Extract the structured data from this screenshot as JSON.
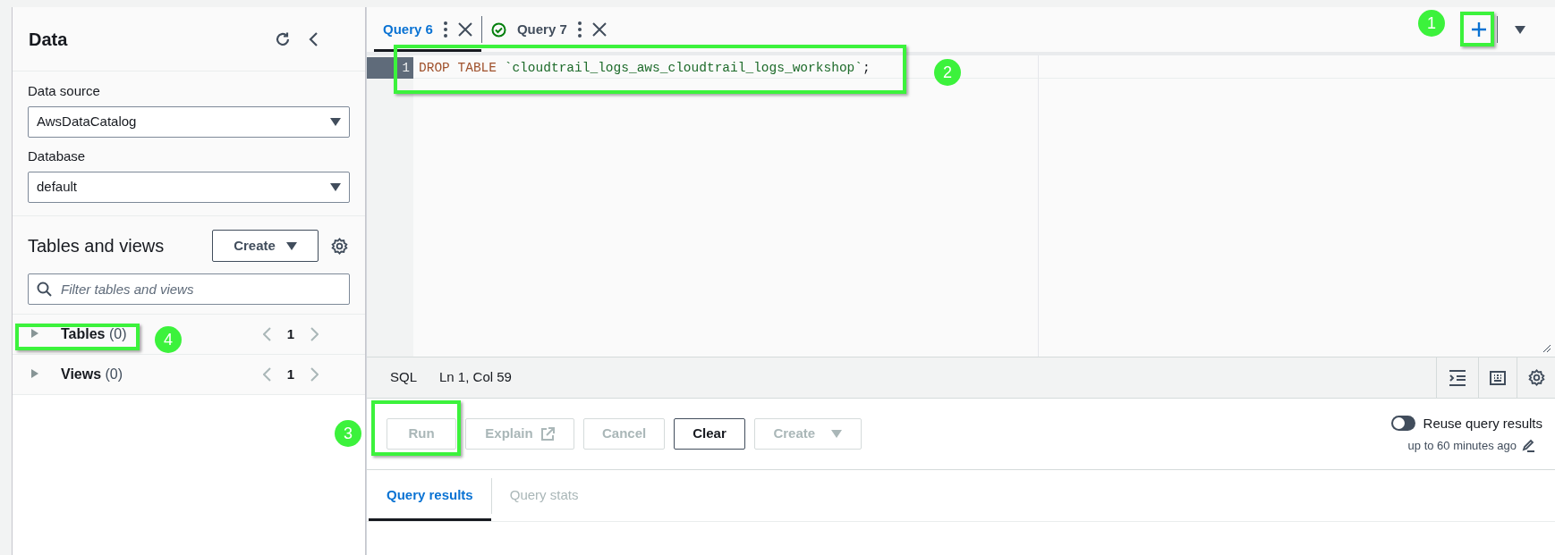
{
  "sidebar": {
    "title": "Data",
    "data_source": {
      "label": "Data source",
      "value": "AwsDataCatalog"
    },
    "database": {
      "label": "Database",
      "value": "default"
    },
    "tables_section": {
      "title": "Tables and views",
      "create_button": "Create",
      "filter": {
        "placeholder": "Filter tables and views"
      },
      "groups": [
        {
          "label": "Tables",
          "count": "(0)",
          "page": "1",
          "expanded": false
        },
        {
          "label": "Views",
          "count": "(0)",
          "page": "1",
          "expanded": false
        }
      ]
    }
  },
  "query_tabs": [
    {
      "label": "Query 6",
      "selected": true,
      "succeeded": false
    },
    {
      "label": "Query 7",
      "selected": false,
      "succeeded": true
    }
  ],
  "editor": {
    "lines": [
      {
        "number": "1",
        "tokens": [
          {
            "kind": "keyword",
            "text": "DROP TABLE"
          },
          {
            "kind": "string",
            "text": "`cloudtrail_logs_aws_cloudtrail_logs_workshop`"
          },
          {
            "kind": "punct",
            "text": ";"
          }
        ]
      }
    ]
  },
  "status_bar": {
    "language": "SQL",
    "position": "Ln 1, Col 59"
  },
  "actions": [
    {
      "label": "Run",
      "kind": "plain",
      "disabled": true
    },
    {
      "label": "Explain",
      "kind": "external",
      "disabled": true
    },
    {
      "label": "Cancel",
      "kind": "plain",
      "disabled": true
    },
    {
      "label": "Clear",
      "kind": "plain",
      "disabled": false
    },
    {
      "label": "Create",
      "kind": "dropdown",
      "disabled": true
    }
  ],
  "reuse": {
    "label": "Reuse query results",
    "on": false,
    "note": "up to 60 minutes ago"
  },
  "result_tabs": [
    {
      "label": "Query results",
      "selected": true
    },
    {
      "label": "Query stats",
      "selected": false
    }
  ],
  "callouts": [
    {
      "label": "1"
    },
    {
      "label": "2"
    },
    {
      "label": "3"
    },
    {
      "label": "4"
    }
  ]
}
